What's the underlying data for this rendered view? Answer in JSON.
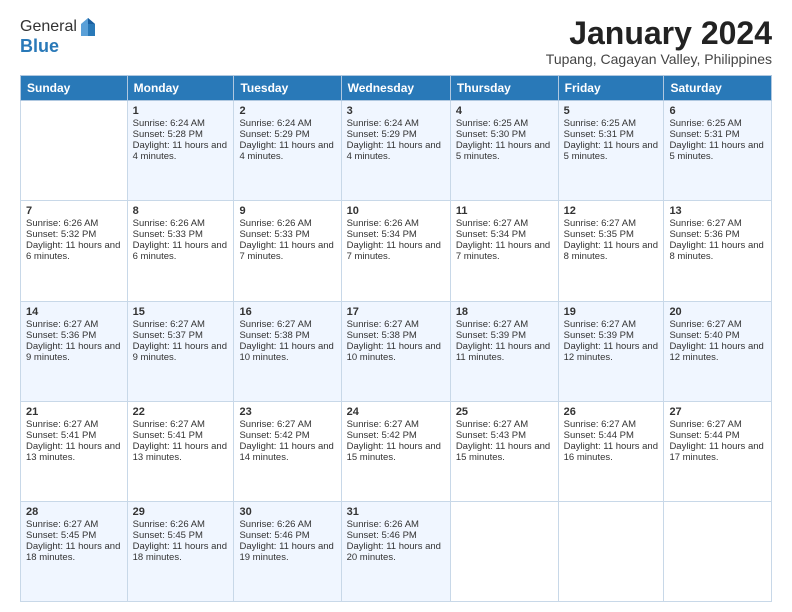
{
  "header": {
    "logo_general": "General",
    "logo_blue": "Blue",
    "month_title": "January 2024",
    "location": "Tupang, Cagayan Valley, Philippines"
  },
  "days_of_week": [
    "Sunday",
    "Monday",
    "Tuesday",
    "Wednesday",
    "Thursday",
    "Friday",
    "Saturday"
  ],
  "weeks": [
    [
      {
        "day": "",
        "sunrise": "",
        "sunset": "",
        "daylight": ""
      },
      {
        "day": "1",
        "sunrise": "Sunrise: 6:24 AM",
        "sunset": "Sunset: 5:28 PM",
        "daylight": "Daylight: 11 hours and 4 minutes."
      },
      {
        "day": "2",
        "sunrise": "Sunrise: 6:24 AM",
        "sunset": "Sunset: 5:29 PM",
        "daylight": "Daylight: 11 hours and 4 minutes."
      },
      {
        "day": "3",
        "sunrise": "Sunrise: 6:24 AM",
        "sunset": "Sunset: 5:29 PM",
        "daylight": "Daylight: 11 hours and 4 minutes."
      },
      {
        "day": "4",
        "sunrise": "Sunrise: 6:25 AM",
        "sunset": "Sunset: 5:30 PM",
        "daylight": "Daylight: 11 hours and 5 minutes."
      },
      {
        "day": "5",
        "sunrise": "Sunrise: 6:25 AM",
        "sunset": "Sunset: 5:31 PM",
        "daylight": "Daylight: 11 hours and 5 minutes."
      },
      {
        "day": "6",
        "sunrise": "Sunrise: 6:25 AM",
        "sunset": "Sunset: 5:31 PM",
        "daylight": "Daylight: 11 hours and 5 minutes."
      }
    ],
    [
      {
        "day": "7",
        "sunrise": "Sunrise: 6:26 AM",
        "sunset": "Sunset: 5:32 PM",
        "daylight": "Daylight: 11 hours and 6 minutes."
      },
      {
        "day": "8",
        "sunrise": "Sunrise: 6:26 AM",
        "sunset": "Sunset: 5:33 PM",
        "daylight": "Daylight: 11 hours and 6 minutes."
      },
      {
        "day": "9",
        "sunrise": "Sunrise: 6:26 AM",
        "sunset": "Sunset: 5:33 PM",
        "daylight": "Daylight: 11 hours and 7 minutes."
      },
      {
        "day": "10",
        "sunrise": "Sunrise: 6:26 AM",
        "sunset": "Sunset: 5:34 PM",
        "daylight": "Daylight: 11 hours and 7 minutes."
      },
      {
        "day": "11",
        "sunrise": "Sunrise: 6:27 AM",
        "sunset": "Sunset: 5:34 PM",
        "daylight": "Daylight: 11 hours and 7 minutes."
      },
      {
        "day": "12",
        "sunrise": "Sunrise: 6:27 AM",
        "sunset": "Sunset: 5:35 PM",
        "daylight": "Daylight: 11 hours and 8 minutes."
      },
      {
        "day": "13",
        "sunrise": "Sunrise: 6:27 AM",
        "sunset": "Sunset: 5:36 PM",
        "daylight": "Daylight: 11 hours and 8 minutes."
      }
    ],
    [
      {
        "day": "14",
        "sunrise": "Sunrise: 6:27 AM",
        "sunset": "Sunset: 5:36 PM",
        "daylight": "Daylight: 11 hours and 9 minutes."
      },
      {
        "day": "15",
        "sunrise": "Sunrise: 6:27 AM",
        "sunset": "Sunset: 5:37 PM",
        "daylight": "Daylight: 11 hours and 9 minutes."
      },
      {
        "day": "16",
        "sunrise": "Sunrise: 6:27 AM",
        "sunset": "Sunset: 5:38 PM",
        "daylight": "Daylight: 11 hours and 10 minutes."
      },
      {
        "day": "17",
        "sunrise": "Sunrise: 6:27 AM",
        "sunset": "Sunset: 5:38 PM",
        "daylight": "Daylight: 11 hours and 10 minutes."
      },
      {
        "day": "18",
        "sunrise": "Sunrise: 6:27 AM",
        "sunset": "Sunset: 5:39 PM",
        "daylight": "Daylight: 11 hours and 11 minutes."
      },
      {
        "day": "19",
        "sunrise": "Sunrise: 6:27 AM",
        "sunset": "Sunset: 5:39 PM",
        "daylight": "Daylight: 11 hours and 12 minutes."
      },
      {
        "day": "20",
        "sunrise": "Sunrise: 6:27 AM",
        "sunset": "Sunset: 5:40 PM",
        "daylight": "Daylight: 11 hours and 12 minutes."
      }
    ],
    [
      {
        "day": "21",
        "sunrise": "Sunrise: 6:27 AM",
        "sunset": "Sunset: 5:41 PM",
        "daylight": "Daylight: 11 hours and 13 minutes."
      },
      {
        "day": "22",
        "sunrise": "Sunrise: 6:27 AM",
        "sunset": "Sunset: 5:41 PM",
        "daylight": "Daylight: 11 hours and 13 minutes."
      },
      {
        "day": "23",
        "sunrise": "Sunrise: 6:27 AM",
        "sunset": "Sunset: 5:42 PM",
        "daylight": "Daylight: 11 hours and 14 minutes."
      },
      {
        "day": "24",
        "sunrise": "Sunrise: 6:27 AM",
        "sunset": "Sunset: 5:42 PM",
        "daylight": "Daylight: 11 hours and 15 minutes."
      },
      {
        "day": "25",
        "sunrise": "Sunrise: 6:27 AM",
        "sunset": "Sunset: 5:43 PM",
        "daylight": "Daylight: 11 hours and 15 minutes."
      },
      {
        "day": "26",
        "sunrise": "Sunrise: 6:27 AM",
        "sunset": "Sunset: 5:44 PM",
        "daylight": "Daylight: 11 hours and 16 minutes."
      },
      {
        "day": "27",
        "sunrise": "Sunrise: 6:27 AM",
        "sunset": "Sunset: 5:44 PM",
        "daylight": "Daylight: 11 hours and 17 minutes."
      }
    ],
    [
      {
        "day": "28",
        "sunrise": "Sunrise: 6:27 AM",
        "sunset": "Sunset: 5:45 PM",
        "daylight": "Daylight: 11 hours and 18 minutes."
      },
      {
        "day": "29",
        "sunrise": "Sunrise: 6:26 AM",
        "sunset": "Sunset: 5:45 PM",
        "daylight": "Daylight: 11 hours and 18 minutes."
      },
      {
        "day": "30",
        "sunrise": "Sunrise: 6:26 AM",
        "sunset": "Sunset: 5:46 PM",
        "daylight": "Daylight: 11 hours and 19 minutes."
      },
      {
        "day": "31",
        "sunrise": "Sunrise: 6:26 AM",
        "sunset": "Sunset: 5:46 PM",
        "daylight": "Daylight: 11 hours and 20 minutes."
      },
      {
        "day": "",
        "sunrise": "",
        "sunset": "",
        "daylight": ""
      },
      {
        "day": "",
        "sunrise": "",
        "sunset": "",
        "daylight": ""
      },
      {
        "day": "",
        "sunrise": "",
        "sunset": "",
        "daylight": ""
      }
    ]
  ]
}
